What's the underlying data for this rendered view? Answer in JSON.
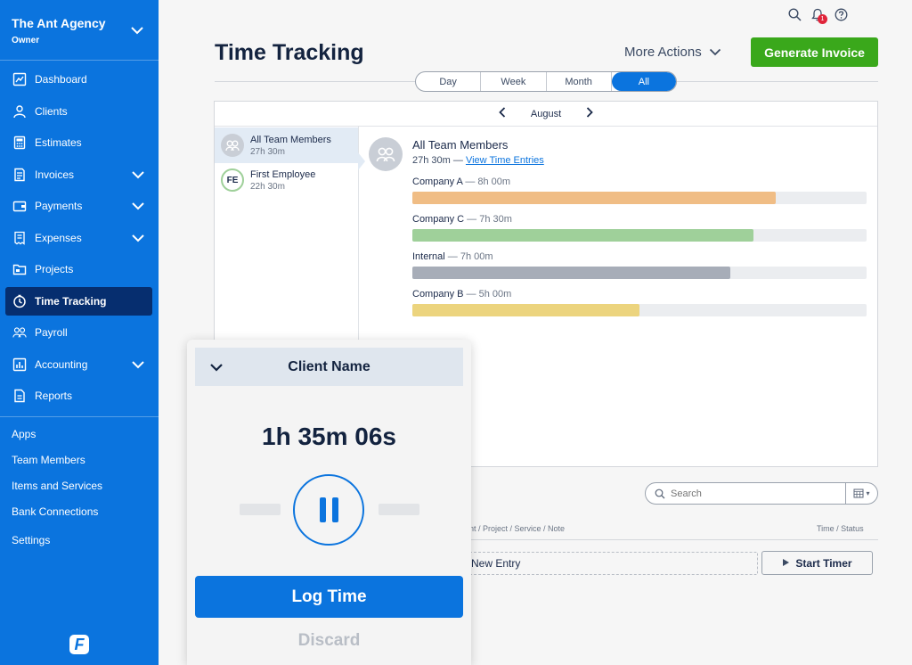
{
  "sidebar": {
    "org_name": "The Ant Agency",
    "org_role": "Owner",
    "items": [
      {
        "label": "Dashboard",
        "icon": "chart-icon"
      },
      {
        "label": "Clients",
        "icon": "user-icon"
      },
      {
        "label": "Estimates",
        "icon": "calculator-icon"
      },
      {
        "label": "Invoices",
        "icon": "invoice-icon"
      },
      {
        "label": "Payments",
        "icon": "payment-icon"
      },
      {
        "label": "Expenses",
        "icon": "receipt-icon"
      },
      {
        "label": "Projects",
        "icon": "folder-icon"
      },
      {
        "label": "Time Tracking",
        "icon": "clock-icon"
      },
      {
        "label": "Payroll",
        "icon": "people-icon"
      },
      {
        "label": "Accounting",
        "icon": "bar-chart-icon"
      },
      {
        "label": "Reports",
        "icon": "report-icon"
      }
    ],
    "links": [
      "Apps",
      "Team Members",
      "Items and Services",
      "Bank Connections",
      "Settings"
    ],
    "brand_letter": "F"
  },
  "topbar": {
    "notification_count": "1"
  },
  "header": {
    "title": "Time Tracking",
    "more_actions": "More Actions",
    "generate_invoice": "Generate Invoice"
  },
  "range_tabs": [
    "Day",
    "Week",
    "Month",
    "All"
  ],
  "month_nav": {
    "month": "August"
  },
  "members": [
    {
      "name": "All Team Members",
      "time": "27h 30m",
      "initials": ""
    },
    {
      "name": "First Employee",
      "time": "22h 30m",
      "initials": "FE"
    }
  ],
  "detail": {
    "name": "All Team Members",
    "total": "27h 30m —",
    "link": "View Time Entries",
    "bars": [
      {
        "label": "Company A",
        "time": "— 8h 00m",
        "fraction": 0.8,
        "color": "#f0bd85"
      },
      {
        "label": "Company C",
        "time": "— 7h 30m",
        "fraction": 0.75,
        "color": "#9fd09a"
      },
      {
        "label": "Internal",
        "time": "— 7h 00m",
        "fraction": 0.7,
        "color": "#a7adb8"
      },
      {
        "label": "Company B",
        "time": "— 5h 00m",
        "fraction": 0.5,
        "color": "#ecd47e"
      }
    ]
  },
  "entries": {
    "search_placeholder": "Search",
    "col_left": "nt / Project / Service / Note",
    "col_right": "Time / Status",
    "new_entry": "New Entry",
    "start_timer": "Start Timer"
  },
  "timer": {
    "client": "Client Name",
    "elapsed": "1h 35m 06s",
    "log_time": "Log Time",
    "discard": "Discard"
  },
  "colors": {
    "brand_blue": "#0b74de",
    "sidebar_active": "#062e6f",
    "invoice_green": "#3aa81b"
  }
}
